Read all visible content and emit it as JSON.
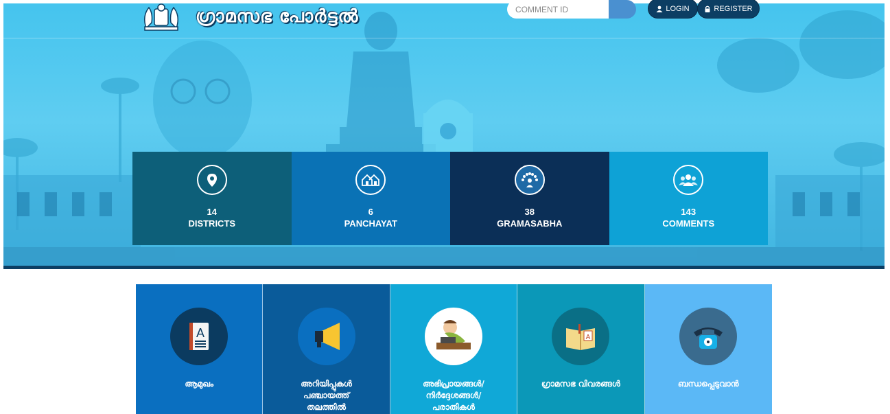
{
  "header": {
    "site_title": "ഗ്രാമസഭ പോർട്ടൽ",
    "comment_search": {
      "placeholder": "COMMENT ID",
      "value": ""
    },
    "login_label": "LOGIN",
    "register_label": "REGISTER"
  },
  "stats": [
    {
      "count": "14",
      "label": "DISTRICTS",
      "icon": "location-pin-icon",
      "color": "#0d5f79"
    },
    {
      "count": "6",
      "label": "PANCHAYAT",
      "icon": "houses-icon",
      "color": "#0a72b5"
    },
    {
      "count": "38",
      "label": "GRAMASABHA",
      "icon": "people-group-icon",
      "color": "#0b2f57"
    },
    {
      "count": "143",
      "label": "COMMENTS",
      "icon": "users-icon",
      "color": "#0ea2d6"
    }
  ],
  "tiles": [
    {
      "label": "ആമുഖം",
      "icon": "address-book-icon",
      "color": "#0a6fc0",
      "icon_bg": "#0b3b60"
    },
    {
      "label": "അറിയിപ്പുകൾ\nപഞ്ചായത്ത്\nതലത്തിൽ",
      "icon": "megaphone-icon",
      "color": "#0a5b9a",
      "icon_bg": "#0a6fc0"
    },
    {
      "label": "അഭിപ്രായങ്ങൾ/\nനിർദ്ദേശങ്ങൾ/\nപരാതികൾ",
      "icon": "writer-icon",
      "color": "#10a8d7",
      "icon_bg": "#ffffff"
    },
    {
      "label": "ഗ്രാമസഭ വിവരങ്ങൾ",
      "icon": "open-book-icon",
      "color": "#0b98b8",
      "icon_bg": "#0a6f86"
    },
    {
      "label": "ബന്ധപ്പെടുവാൻ",
      "icon": "telephone-icon",
      "color": "#5bb8f6",
      "icon_bg": "#3a6b8e"
    }
  ],
  "colors": {
    "hero": "#45c4ee",
    "navy": "#0c3e63",
    "accent": "#4a90d0"
  }
}
